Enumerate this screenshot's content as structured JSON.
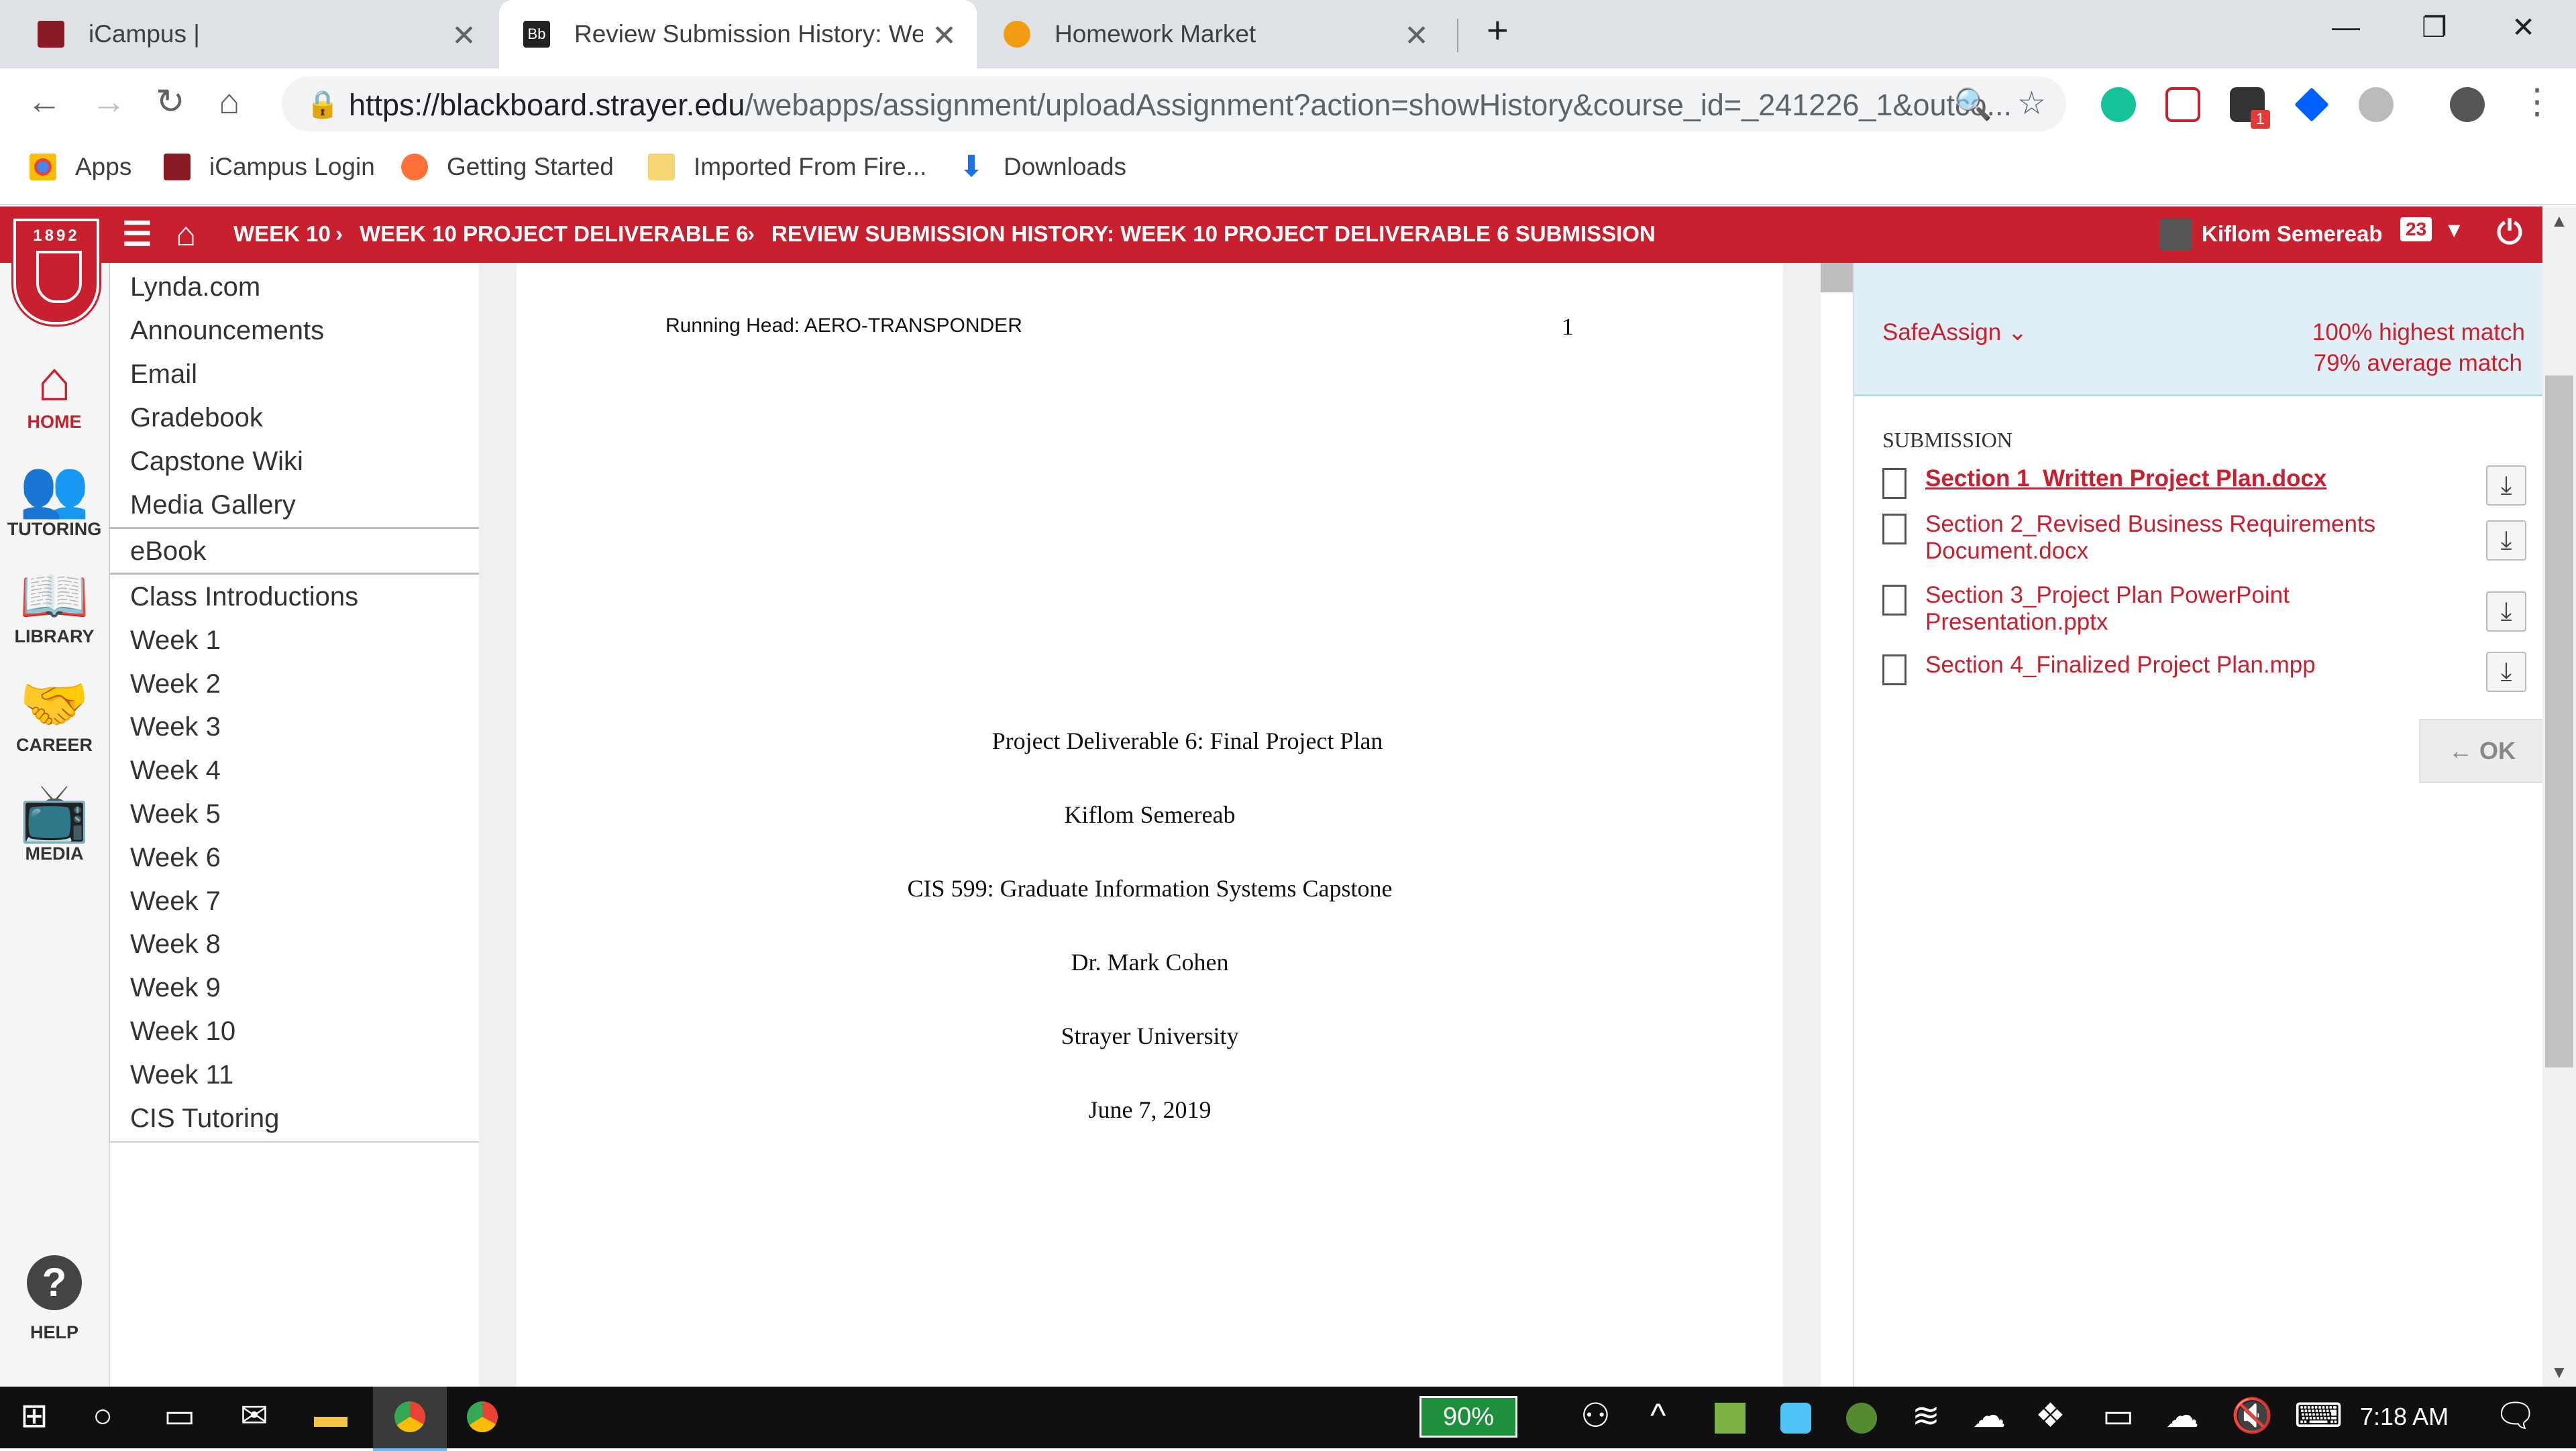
{
  "browser": {
    "tabs": [
      {
        "title": "iCampus |"
      },
      {
        "title": "Review Submission History: Week"
      },
      {
        "title": "Homework Market"
      }
    ],
    "url_host": "https://blackboard.strayer.edu",
    "url_path": "/webapps/assignment/uploadAssignment?action=showHistory&course_id=_241226_1&outco...",
    "profile_badge": "1",
    "bookmarks": [
      "Apps",
      "iCampus Login",
      "Getting Started",
      "Imported From Fire...",
      "Downloads"
    ]
  },
  "bb_header": {
    "crumb_1": "WEEK 10",
    "crumb_2": "WEEK 10 PROJECT DELIVERABLE 6",
    "crumb_3": "REVIEW SUBMISSION HISTORY: WEEK 10 PROJECT DELIVERABLE 6 SUBMISSION",
    "user_name": "Kiflom Semereab",
    "notification_count": "23",
    "logo_year": "1892"
  },
  "rail": {
    "home": "HOME",
    "tutoring": "TUTORING",
    "library": "LIBRARY",
    "career": "CAREER",
    "media": "MEDIA",
    "help": "HELP"
  },
  "course_menu": {
    "items_top": [
      "Lynda.com",
      "Announcements",
      "Email",
      "Gradebook",
      "Capstone Wiki",
      "Media Gallery"
    ],
    "ebook": "eBook",
    "items_bottom": [
      "Class Introductions",
      "Week 1",
      "Week 2",
      "Week 3",
      "Week 4",
      "Week 5",
      "Week 6",
      "Week 7",
      "Week 8",
      "Week 9",
      "Week 10",
      "Week 11",
      "CIS Tutoring"
    ]
  },
  "document": {
    "running_head": "Running Head: AERO-TRANSPONDER",
    "page_number": "1",
    "title": "Project Deliverable 6: Final Project Plan",
    "author": "Kiflom Semereab",
    "course": "CIS 599: Graduate Information Systems Capstone",
    "instructor": "Dr. Mark Cohen",
    "university": "Strayer University",
    "date": "June 7, 2019"
  },
  "right_panel": {
    "safeassign_label": "SafeAssign",
    "highest_match": "100% highest match",
    "average_match": "79% average match",
    "submission_heading": "SUBMISSION",
    "files": [
      "Section 1_Written Project Plan.docx",
      "Section 2_Revised Business Requirements Document.docx",
      "Section 3_Project Plan PowerPoint Presentation.pptx",
      "Section 4_Finalized Project Plan.mpp"
    ],
    "ok_label": "← OK"
  },
  "taskbar": {
    "battery": "90%",
    "time": "7:18 AM"
  },
  "colors": {
    "brand_red": "#c8202f",
    "safeassign_bg": "#e0eff5"
  }
}
